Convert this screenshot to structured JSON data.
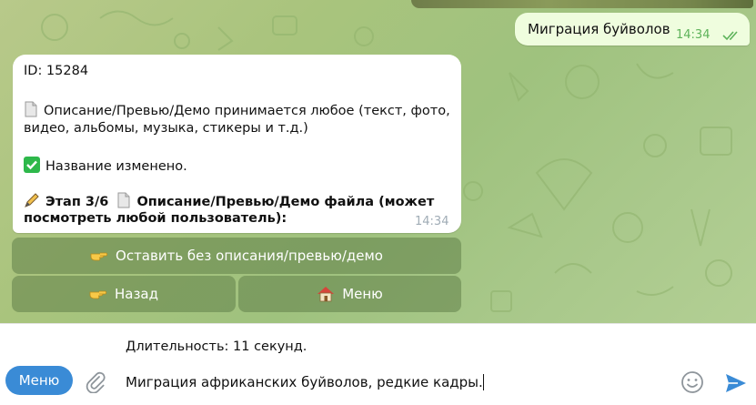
{
  "chat": {
    "outgoing": {
      "text": "Миграция буйволов",
      "time": "14:34",
      "status": "read"
    },
    "incoming": {
      "id_line": "ID: 15284",
      "desc_line1": "Описание/Превью/Демо принимается любое (текст, фото,",
      "desc_line2": "видео, альбомы, музыка, стикеры и т.д.)",
      "renamed": "Название изменено.",
      "step_line1": "Этап 3/6",
      "step_line1_rest": "Описание/Превью/Демо файла (может",
      "step_line2": "посмотреть любой пользователь):",
      "time": "14:34"
    },
    "keyboard": {
      "skip_label": "Оставить без описания/превью/демо",
      "back_label": "Назад",
      "menu_label": "Меню"
    }
  },
  "composer": {
    "caption_line": "Длительность: 11 секунд.",
    "input_value": "Миграция африканских буйволов, редкие кадры.",
    "menu_button": "Меню"
  },
  "colors": {
    "accent": "#3a8bd6",
    "outgoing_bubble": "#effdde",
    "read_check": "#5eb35a",
    "keyboard_button": "#6a8a4e"
  },
  "icons": [
    "page-icon",
    "check-mark-icon",
    "pencil-icon",
    "pointing-hand-icon",
    "house-icon",
    "paperclip-icon",
    "smile-icon",
    "send-icon",
    "double-check-icon"
  ]
}
